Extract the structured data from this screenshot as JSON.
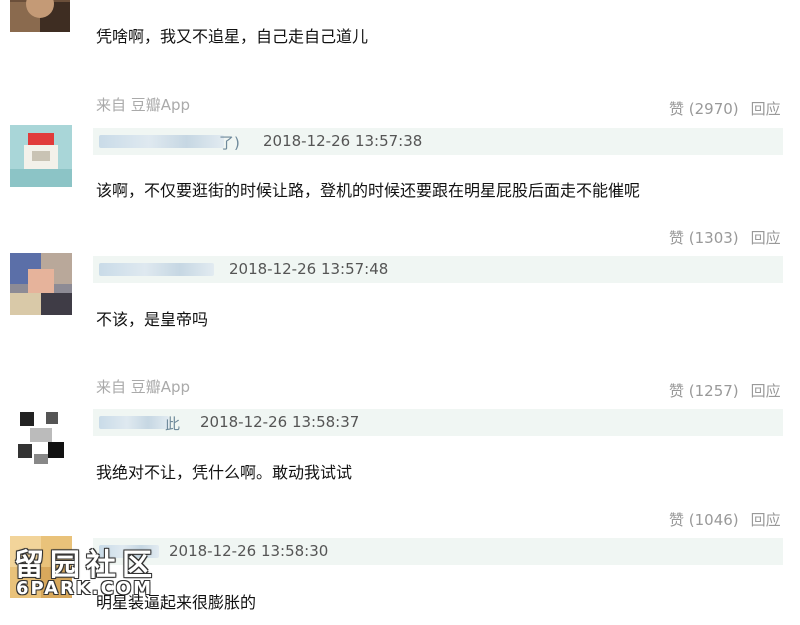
{
  "comments": [
    {
      "text": "凭啥啊，我又不追星，自己走自己道儿",
      "source": "来自 豆瓣App",
      "likes": "赞 (2970)",
      "reply": "回应"
    },
    {
      "name_tail": "了)",
      "timestamp": "2018-12-26 13:57:38",
      "text": "该啊，不仅要逛街的时候让路，登机的时候还要跟在明星屁股后面走不能催呢",
      "likes": "赞 (1303)",
      "reply": "回应"
    },
    {
      "timestamp": "2018-12-26 13:57:48",
      "text": "不该，是皇帝吗",
      "source": "来自 豆瓣App",
      "likes": "赞 (1257)",
      "reply": "回应"
    },
    {
      "name_tail": "此",
      "timestamp": "2018-12-26 13:58:37",
      "text": "我绝对不让，凭什么啊。敢动我试试",
      "likes": "赞 (1046)",
      "reply": "回应"
    },
    {
      "timestamp": "2018-12-26 13:58:30",
      "text": "明星装逼起来很膨胀的"
    }
  ],
  "watermark": {
    "title": "留园社区",
    "subtitle": "6PARK.COM"
  }
}
